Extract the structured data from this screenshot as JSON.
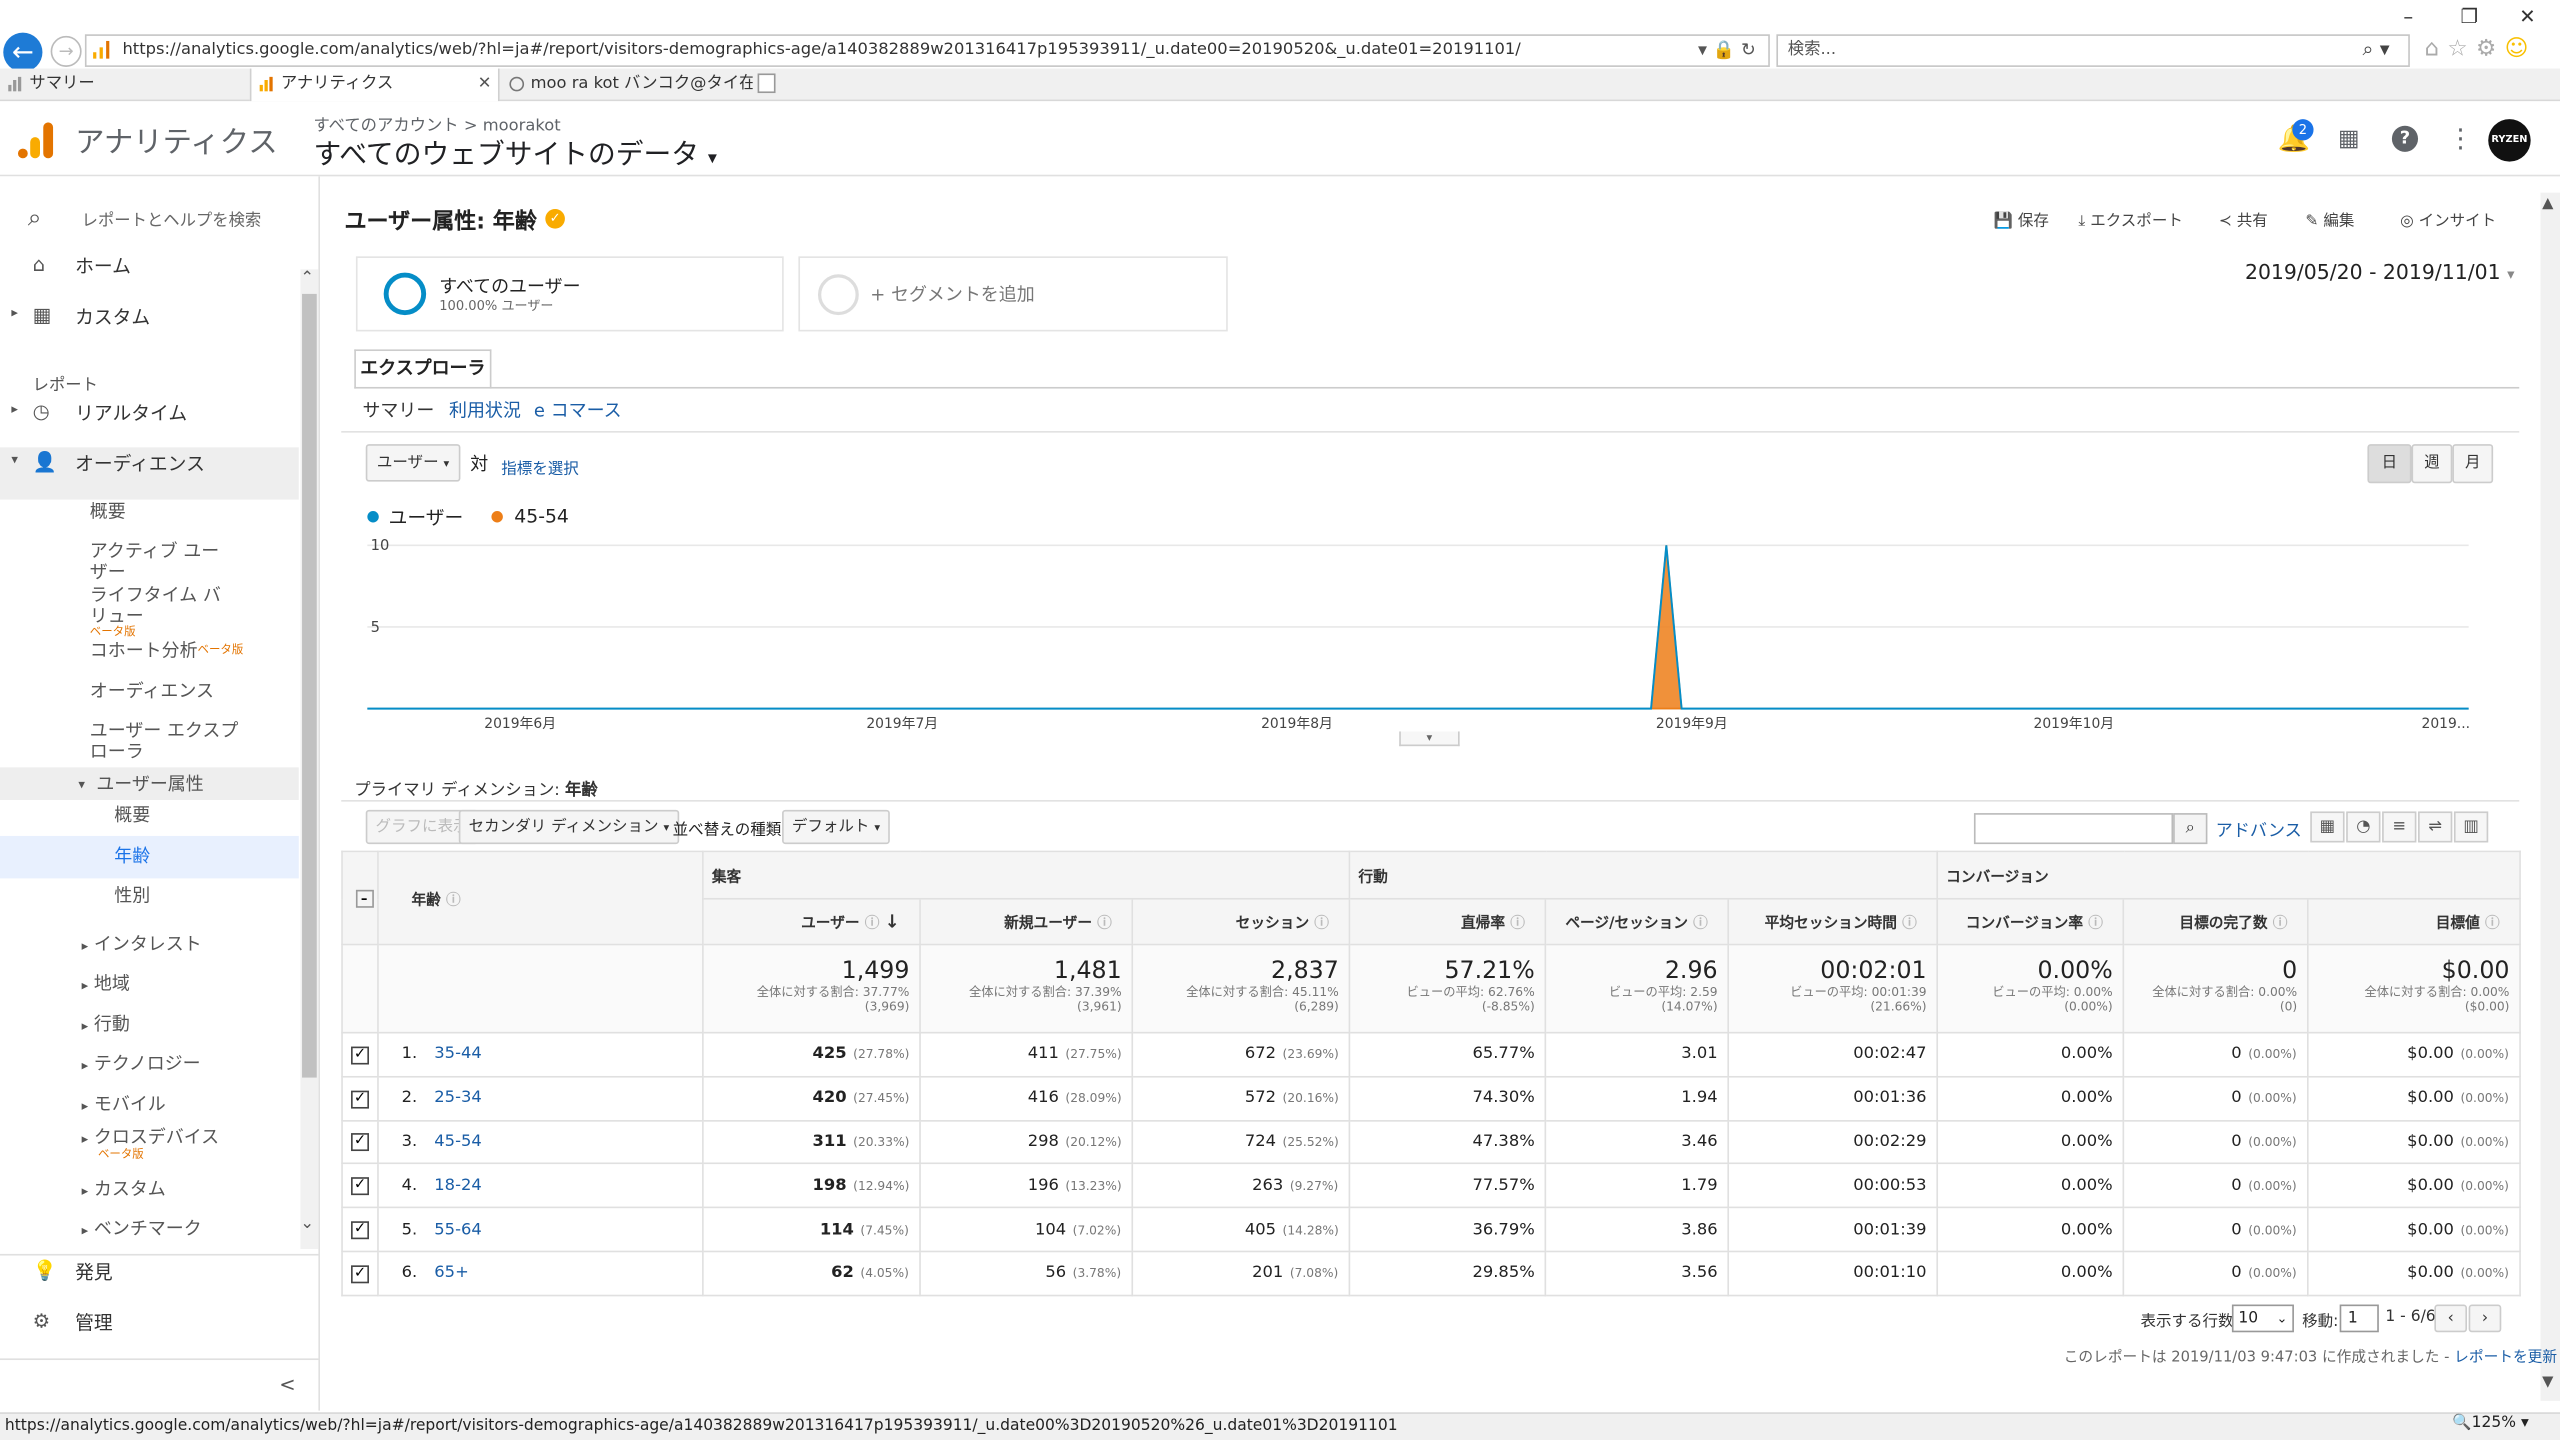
{
  "browser": {
    "url": "https://analytics.google.com/analytics/web/?hl=ja#/report/visitors-demographics-age/a140382889w201316417p195393911/_u.date00=20190520&_u.date01=20191101/",
    "search_placeholder": "検索...",
    "tabs": [
      {
        "label": "サマリー"
      },
      {
        "label": "アナリティクス"
      },
      {
        "label": "moo ra kot バンコク@タイ在住／..."
      }
    ],
    "status_url": "https://analytics.google.com/analytics/web/?hl=ja#/report/visitors-demographics-age/a140382889w201316417p195393911/_u.date00%3D20190520%26_u.date01%3D20191101",
    "zoom": "125%"
  },
  "header": {
    "app_name": "アナリティクス",
    "breadcrumb_root": "すべてのアカウント",
    "breadcrumb_sep": ">",
    "breadcrumb_account": "moorakot",
    "property": "すべてのウェブサイトのデータ",
    "notification_count": "2",
    "avatar_text": "RYZEN"
  },
  "sidebar": {
    "search": "レポートとヘルプを検索",
    "home": "ホーム",
    "custom": "カスタム",
    "reports_heading": "レポート",
    "realtime": "リアルタイム",
    "audience": "オーディエンス",
    "overview": "概要",
    "active_users_1": "アクティブ ユー",
    "active_users_2": "ザー",
    "lifetime_1": "ライフタイム バ",
    "lifetime_2": "リュー",
    "beta": "ベータ版",
    "cohort": "コホート分析",
    "audiences": "オーディエンス",
    "explorer_1": "ユーザー エクスプ",
    "explorer_2": "ローラ",
    "demographics": "ユーザー属性",
    "demo_overview": "概要",
    "age": "年齢",
    "gender": "性別",
    "interests": "インタレスト",
    "geo": "地域",
    "behavior": "行動",
    "technology": "テクノロジー",
    "mobile": "モバイル",
    "cross_device": "クロスデバイス",
    "custom_sub": "カスタム",
    "benchmark": "ベンチマーク",
    "discover": "発見",
    "admin": "管理",
    "collapse": "<"
  },
  "report": {
    "title": "ユーザー属性: 年齢",
    "actions": {
      "save": "保存",
      "export": "エクスポート",
      "share": "共有",
      "edit": "編集",
      "insight": "インサイト"
    },
    "segment_name": "すべてのユーザー",
    "segment_pct": "100.00% ユーザー",
    "add_segment": "+ セグメントを追加",
    "date_range": "2019/05/20 - 2019/11/01",
    "explorer_tab": "エクスプローラ",
    "subtabs": [
      "サマリー",
      "利用状況",
      "e コマース"
    ],
    "metric_select": "ユーザー",
    "vs": "対",
    "choose_metric": "指標を選択",
    "granularity": [
      "日",
      "週",
      "月"
    ],
    "primary_dimension_label": "プライマリ ディメンション:",
    "primary_dimension": "年齢",
    "btn_graph": "グラフに表示",
    "btn_secondary": "セカンダリ ディメンション",
    "sort_label": "並べ替えの種類:",
    "sort_value": "デフォルト",
    "advanced": "アドバンス"
  },
  "chart_data": {
    "type": "area",
    "series": [
      {
        "name": "ユーザー",
        "color": "#058dc7"
      },
      {
        "name": "45-54",
        "color": "#ed7e17"
      }
    ],
    "y_ticks": [
      "10",
      "5"
    ],
    "ylim": [
      0,
      10
    ],
    "x_ticks": [
      "2019年6月",
      "2019年7月",
      "2019年8月",
      "2019年9月",
      "2019年10月",
      "2019..."
    ],
    "peak": {
      "x": "2019-08-30",
      "value": 10
    }
  },
  "table": {
    "groups": {
      "acquisition": "集客",
      "behavior": "行動",
      "conversion": "コンバージョン"
    },
    "dim_header": "年齢",
    "columns": [
      "ユーザー",
      "新規ユーザー",
      "セッション",
      "直帰率",
      "ページ/セッション",
      "平均セッション時間",
      "コンバージョン率",
      "目標の完了数",
      "目標値"
    ],
    "totals": [
      {
        "value": "1,499",
        "sub1": "全体に対する割合: 37.77%",
        "sub2": "(3,969)"
      },
      {
        "value": "1,481",
        "sub1": "全体に対する割合: 37.39%",
        "sub2": "(3,961)"
      },
      {
        "value": "2,837",
        "sub1": "全体に対する割合: 45.11%",
        "sub2": "(6,289)"
      },
      {
        "value": "57.21%",
        "sub1": "ビューの平均: 62.76%",
        "sub2": "(-8.85%)"
      },
      {
        "value": "2.96",
        "sub1": "ビューの平均: 2.59",
        "sub2": "(14.07%)"
      },
      {
        "value": "00:02:01",
        "sub1": "ビューの平均: 00:01:39",
        "sub2": "(21.66%)"
      },
      {
        "value": "0.00%",
        "sub1": "ビューの平均: 0.00%",
        "sub2": "(0.00%)"
      },
      {
        "value": "0",
        "sub1": "全体に対する割合: 0.00%",
        "sub2": "(0)"
      },
      {
        "value": "$0.00",
        "sub1": "全体に対する割合: 0.00%",
        "sub2": "($0.00)"
      }
    ],
    "rows": [
      {
        "idx": "1.",
        "age": "35-44",
        "users": "425",
        "users_pct": "(27.78%)",
        "new": "411",
        "new_pct": "(27.75%)",
        "sess": "672",
        "sess_pct": "(23.69%)",
        "bounce": "65.77%",
        "pps": "3.01",
        "dur": "00:02:47",
        "cr": "0.00%",
        "goals": "0",
        "goals_pct": "(0.00%)",
        "gv": "$0.00",
        "gv_pct": "(0.00%)"
      },
      {
        "idx": "2.",
        "age": "25-34",
        "users": "420",
        "users_pct": "(27.45%)",
        "new": "416",
        "new_pct": "(28.09%)",
        "sess": "572",
        "sess_pct": "(20.16%)",
        "bounce": "74.30%",
        "pps": "1.94",
        "dur": "00:01:36",
        "cr": "0.00%",
        "goals": "0",
        "goals_pct": "(0.00%)",
        "gv": "$0.00",
        "gv_pct": "(0.00%)"
      },
      {
        "idx": "3.",
        "age": "45-54",
        "users": "311",
        "users_pct": "(20.33%)",
        "new": "298",
        "new_pct": "(20.12%)",
        "sess": "724",
        "sess_pct": "(25.52%)",
        "bounce": "47.38%",
        "pps": "3.46",
        "dur": "00:02:29",
        "cr": "0.00%",
        "goals": "0",
        "goals_pct": "(0.00%)",
        "gv": "$0.00",
        "gv_pct": "(0.00%)"
      },
      {
        "idx": "4.",
        "age": "18-24",
        "users": "198",
        "users_pct": "(12.94%)",
        "new": "196",
        "new_pct": "(13.23%)",
        "sess": "263",
        "sess_pct": "(9.27%)",
        "bounce": "77.57%",
        "pps": "1.79",
        "dur": "00:00:53",
        "cr": "0.00%",
        "goals": "0",
        "goals_pct": "(0.00%)",
        "gv": "$0.00",
        "gv_pct": "(0.00%)"
      },
      {
        "idx": "5.",
        "age": "55-64",
        "users": "114",
        "users_pct": "(7.45%)",
        "new": "104",
        "new_pct": "(7.02%)",
        "sess": "405",
        "sess_pct": "(14.28%)",
        "bounce": "36.79%",
        "pps": "3.86",
        "dur": "00:01:39",
        "cr": "0.00%",
        "goals": "0",
        "goals_pct": "(0.00%)",
        "gv": "$0.00",
        "gv_pct": "(0.00%)"
      },
      {
        "idx": "6.",
        "age": "65+",
        "users": "62",
        "users_pct": "(4.05%)",
        "new": "56",
        "new_pct": "(3.78%)",
        "sess": "201",
        "sess_pct": "(7.08%)",
        "bounce": "29.85%",
        "pps": "3.56",
        "dur": "00:01:10",
        "cr": "0.00%",
        "goals": "0",
        "goals_pct": "(0.00%)",
        "gv": "$0.00",
        "gv_pct": "(0.00%)"
      }
    ],
    "pager": {
      "rows_label": "表示する行数:",
      "rows_value": "10",
      "goto_label": "移動:",
      "goto_value": "1",
      "range": "1 - 6/6"
    },
    "generated_note": "このレポートは 2019/11/03 9:47:03 に作成されました -",
    "refresh": "レポートを更新"
  }
}
